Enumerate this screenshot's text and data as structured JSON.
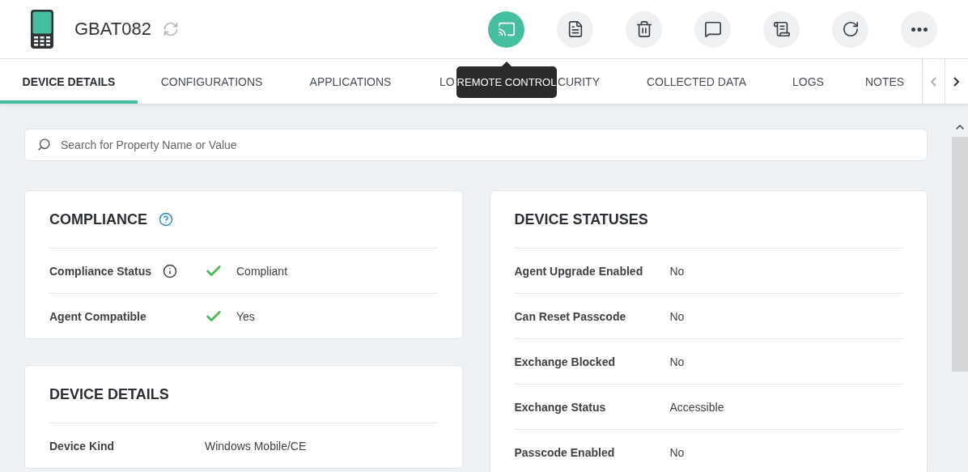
{
  "device": {
    "name": "GBAT082"
  },
  "actions": [
    {
      "kind": "remote",
      "selected": true
    },
    {
      "kind": "document",
      "selected": false
    },
    {
      "kind": "delete",
      "selected": false
    },
    {
      "kind": "message",
      "selected": false
    },
    {
      "kind": "notes",
      "selected": false
    },
    {
      "kind": "refresh",
      "selected": false
    },
    {
      "kind": "more",
      "selected": false
    }
  ],
  "tooltip": {
    "text": "REMOTE CONTROL"
  },
  "tabs": [
    {
      "label": "DEVICE DETAILS",
      "selected": true
    },
    {
      "label": "CONFIGURATIONS",
      "selected": false
    },
    {
      "label": "APPLICATIONS",
      "selected": false
    },
    {
      "label": "LO",
      "selected": false
    },
    {
      "label": "CURITY",
      "selected": false
    },
    {
      "label": "COLLECTED DATA",
      "selected": false
    },
    {
      "label": "LOGS",
      "selected": false
    },
    {
      "label": "NOTES",
      "selected": false
    }
  ],
  "search": {
    "placeholder": "Search for Property Name or Value"
  },
  "columns": [
    {
      "sections": [
        {
          "title": "COMPLIANCE",
          "help": true,
          "rows": [
            {
              "label": "Compliance Status",
              "info": true,
              "check": true,
              "value": "Compliant"
            },
            {
              "label": "Agent Compatible",
              "info": false,
              "check": true,
              "value": "Yes"
            }
          ]
        },
        {
          "title": "DEVICE DETAILS",
          "help": false,
          "rows": [
            {
              "label": "Device Kind",
              "info": false,
              "check": false,
              "value": "Windows Mobile/CE"
            }
          ]
        }
      ]
    },
    {
      "sections": [
        {
          "title": "DEVICE STATUSES",
          "help": false,
          "rows": [
            {
              "label": "Agent Upgrade Enabled",
              "info": false,
              "check": false,
              "value": "No"
            },
            {
              "label": "Can Reset Passcode",
              "info": false,
              "check": false,
              "value": "No"
            },
            {
              "label": "Exchange Blocked",
              "info": false,
              "check": false,
              "value": "No"
            },
            {
              "label": "Exchange Status",
              "info": false,
              "check": false,
              "value": "Accessible"
            },
            {
              "label": "Passcode Enabled",
              "info": false,
              "check": false,
              "value": "No"
            }
          ]
        }
      ]
    }
  ]
}
